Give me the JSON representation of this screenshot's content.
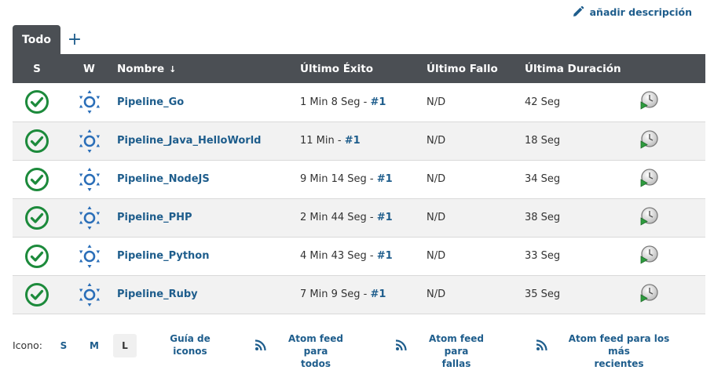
{
  "header": {
    "add_description_label": "añadir descripción"
  },
  "tabs": {
    "active_label": "Todo",
    "add_label": "+"
  },
  "table": {
    "columns": {
      "s": "S",
      "w": "W",
      "name": "Nombre",
      "name_sort": "↓",
      "last_success": "Último Éxito",
      "last_failure": "Último Fallo",
      "last_duration": "Última Duración"
    },
    "rows": [
      {
        "name": "Pipeline_Go",
        "success_time": "1 Min 8 Seg - ",
        "success_build": "#1",
        "failure": "N/D",
        "duration": "42 Seg"
      },
      {
        "name": "Pipeline_Java_HelloWorld",
        "success_time": "11 Min - ",
        "success_build": "#1",
        "failure": "N/D",
        "duration": "18 Seg"
      },
      {
        "name": "Pipeline_NodeJS",
        "success_time": "9 Min 14 Seg - ",
        "success_build": "#1",
        "failure": "N/D",
        "duration": "34 Seg"
      },
      {
        "name": "Pipeline_PHP",
        "success_time": "2 Min 44 Seg - ",
        "success_build": "#1",
        "failure": "N/D",
        "duration": "38 Seg"
      },
      {
        "name": "Pipeline_Python",
        "success_time": "4 Min 43 Seg - ",
        "success_build": "#1",
        "failure": "N/D",
        "duration": "33 Seg"
      },
      {
        "name": "Pipeline_Ruby",
        "success_time": "7 Min 9 Seg - ",
        "success_build": "#1",
        "failure": "N/D",
        "duration": "35 Seg"
      }
    ]
  },
  "footer": {
    "icon_label": "Icono:",
    "sizes": [
      "S",
      "M",
      "L"
    ],
    "active_size": "L",
    "icon_legend_line1": "Guía de",
    "icon_legend_line2": "iconos",
    "feed_all_line1": "Atom feed para",
    "feed_all_line2": "todos",
    "feed_failures_line1": "Atom feed para",
    "feed_failures_line2": "fallas",
    "feed_latest_line1": "Atom feed para los más",
    "feed_latest_line2": "recientes"
  },
  "colors": {
    "header_bg": "#4b4f54",
    "link": "#1e5d8c",
    "success_green": "#1c8a3b",
    "weather_blue": "#2a6eb8"
  },
  "icons": {
    "status": "success-check-icon",
    "weather": "sunny-weather-icon",
    "action": "schedule-build-icon",
    "edit": "pencil-icon",
    "feed": "rss-icon"
  }
}
